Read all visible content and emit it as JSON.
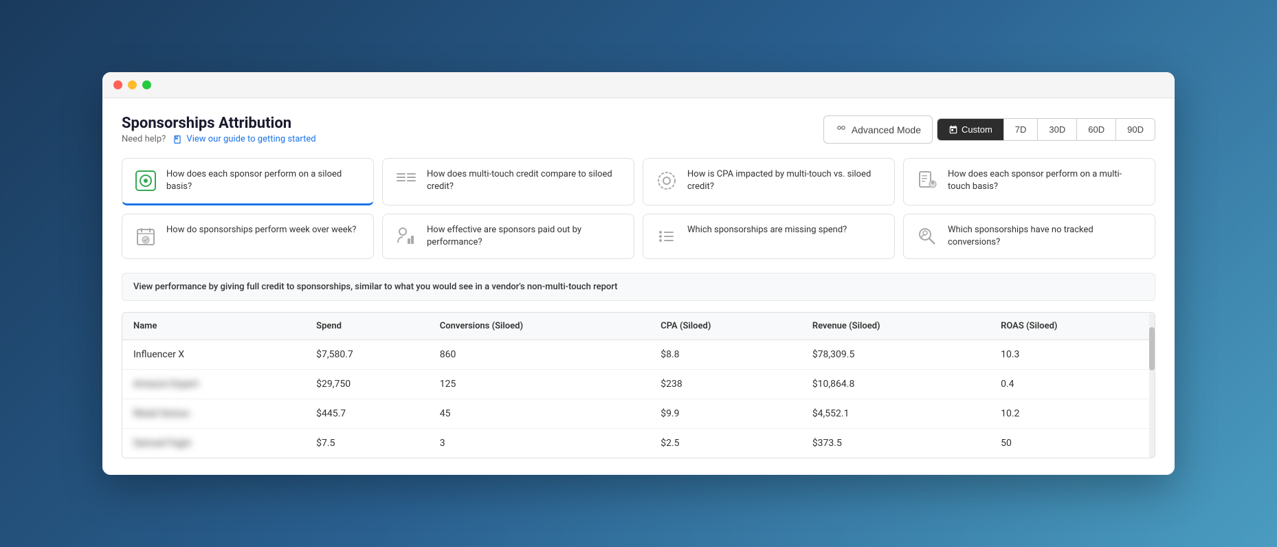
{
  "window": {
    "titlebar": {
      "dots": [
        "red",
        "yellow",
        "green"
      ]
    }
  },
  "header": {
    "title": "Sponsorships Attribution",
    "help_prefix": "Need help?",
    "help_link": "View our guide to getting started",
    "advanced_mode_label": "Advanced Mode",
    "date_tabs": [
      {
        "label": "Custom",
        "active": true,
        "has_icon": true
      },
      {
        "label": "7D",
        "active": false
      },
      {
        "label": "30D",
        "active": false
      },
      {
        "label": "60D",
        "active": false
      },
      {
        "label": "90D",
        "active": false
      }
    ]
  },
  "question_cards": [
    {
      "id": 1,
      "text": "How does each sponsor perform on a siloed basis?",
      "icon": "target-icon",
      "icon_char": "◎",
      "active": true,
      "color": "green"
    },
    {
      "id": 2,
      "text": "How does multi-touch credit compare to siloed credit?",
      "icon": "list-compare-icon",
      "icon_char": "≡",
      "active": false,
      "color": "gray"
    },
    {
      "id": 3,
      "text": "How is CPA impacted by multi-touch vs. siloed credit?",
      "icon": "gear-circle-icon",
      "icon_char": "◌",
      "active": false,
      "color": "gray"
    },
    {
      "id": 4,
      "text": "How does each sponsor perform on a multi-touch basis?",
      "icon": "doc-person-icon",
      "icon_char": "📄",
      "active": false,
      "color": "gray"
    },
    {
      "id": 5,
      "text": "How do sponsorships perform week over week?",
      "icon": "calendar-check-icon",
      "icon_char": "📅",
      "active": false,
      "color": "gray"
    },
    {
      "id": 6,
      "text": "How effective are sponsors paid out by performance?",
      "icon": "person-graph-icon",
      "icon_char": "👤",
      "active": false,
      "color": "gray"
    },
    {
      "id": 7,
      "text": "Which sponsorships are missing spend?",
      "icon": "list-dots-icon",
      "icon_char": "⋮",
      "active": false,
      "color": "gray"
    },
    {
      "id": 8,
      "text": "Which sponsorships have no tracked conversions?",
      "icon": "search-person-icon",
      "icon_char": "🔍",
      "active": false,
      "color": "gray"
    }
  ],
  "description": "View performance by giving full credit to sponsorships, similar to what you would see in a vendor's non-multi-touch report",
  "table": {
    "columns": [
      {
        "key": "name",
        "label": "Name"
      },
      {
        "key": "spend",
        "label": "Spend"
      },
      {
        "key": "conversions",
        "label": "Conversions (Siloed)"
      },
      {
        "key": "cpa",
        "label": "CPA (Siloed)"
      },
      {
        "key": "revenue",
        "label": "Revenue (Siloed)"
      },
      {
        "key": "roas",
        "label": "ROAS (Siloed)"
      }
    ],
    "rows": [
      {
        "name": "Influencer X",
        "spend": "$7,580.7",
        "conversions": "860",
        "cpa": "$8.8",
        "revenue": "$78,309.5",
        "roas": "10.3",
        "blurred": false
      },
      {
        "name": "Amazon Expert",
        "spend": "$29,750",
        "conversions": "125",
        "cpa": "$238",
        "revenue": "$10,864.8",
        "roas": "0.4",
        "blurred": true
      },
      {
        "name": "Retail Genius",
        "spend": "$445.7",
        "conversions": "45",
        "cpa": "$9.9",
        "revenue": "$4,552.1",
        "roas": "10.2",
        "blurred": true
      },
      {
        "name": "Samuel Fagin",
        "spend": "$7.5",
        "conversions": "3",
        "cpa": "$2.5",
        "revenue": "$373.5",
        "roas": "50",
        "blurred": true
      }
    ]
  }
}
